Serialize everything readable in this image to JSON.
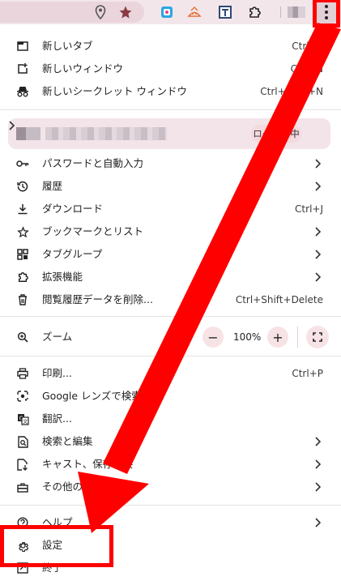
{
  "toolbar": {
    "icons": [
      "location-icon",
      "star-icon",
      "extension-icon-blue",
      "extension-icon-orange",
      "extension-icon-t",
      "puzzle-icon",
      "profile-avatar",
      "kebab-icon"
    ]
  },
  "menu": {
    "new_tab": {
      "label": "新しいタブ",
      "shortcut": "Ctrl+T"
    },
    "new_window": {
      "label": "新しいウィンドウ",
      "shortcut": "Ctrl+N"
    },
    "new_incognito": {
      "label": "新しいシークレット ウィンドウ",
      "shortcut": "Ctrl+Shift+N"
    },
    "profile": {
      "status": "ログイン中"
    },
    "passwords": {
      "label": "パスワードと自動入力"
    },
    "history": {
      "label": "履歴"
    },
    "downloads": {
      "label": "ダウンロード",
      "shortcut": "Ctrl+J"
    },
    "bookmarks": {
      "label": "ブックマークとリスト"
    },
    "tab_groups": {
      "label": "タブグループ"
    },
    "extensions": {
      "label": "拡張機能"
    },
    "clear_data": {
      "label": "閲覧履歴データを削除...",
      "shortcut": "Ctrl+Shift+Delete"
    },
    "zoom": {
      "label": "ズーム",
      "minus": "−",
      "value": "100%",
      "plus": "+"
    },
    "print": {
      "label": "印刷...",
      "shortcut": "Ctrl+P"
    },
    "lens": {
      "label": "Google レンズで検索"
    },
    "translate": {
      "label": "翻訳..."
    },
    "find_edit": {
      "label": "検索と編集"
    },
    "cast_save": {
      "label": "キャスト、保存、共"
    },
    "more_tools": {
      "label": "その他のツール"
    },
    "help": {
      "label": "ヘルプ"
    },
    "settings": {
      "label": "設定"
    },
    "exit": {
      "label": "終了"
    }
  },
  "annotation": {
    "color": "#ff0000"
  }
}
